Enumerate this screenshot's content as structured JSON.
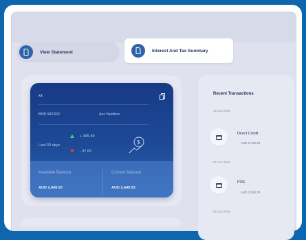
{
  "tabs": {
    "view_statement": "View Statement",
    "interest_summary": "Interest And Tax Summary"
  },
  "card": {
    "account_name": "xx",
    "bsb": "BSB 942302",
    "account_number_label": "Acc Number",
    "period": "Last 30 days",
    "money_in": "+ 305.49",
    "money_out": "- 37.00",
    "available_label": "Available Balance",
    "available_value": "AUD 2,449.93",
    "current_label": "Current Balance",
    "current_value": "AUD 2,449.93"
  },
  "recent": {
    "title": "Recent Transactions",
    "groups": [
      {
        "date": "15 Jun 2026",
        "name": "Direct Credit",
        "amount": "AUD 2,449.93"
      },
      {
        "date": "07 Jun 2026",
        "name": "POE",
        "amount": "AUD 2,263.79"
      },
      {
        "date": "05 Jun 2026"
      }
    ]
  },
  "colors": {
    "frame": "#0e67ad",
    "card_dark": "#173a86",
    "card_light": "#2e67b4",
    "up": "#4bd07a",
    "down": "#e2453e"
  }
}
